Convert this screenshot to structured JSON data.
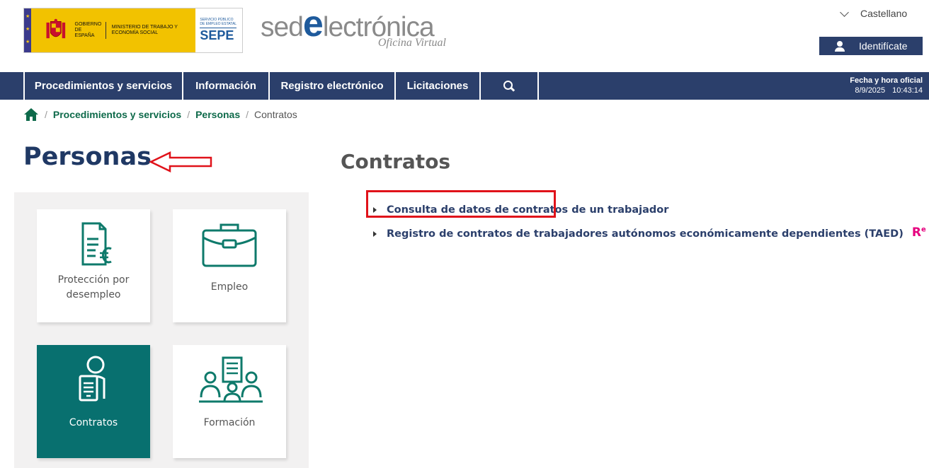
{
  "header": {
    "gov_text_1": "GOBIERNO DE ESPAÑA",
    "gov_text_2": "MINISTERIO DE TRABAJO Y ECONOMÍA SOCIAL",
    "sepe_small": "SERVICIO PÚBLICO DE EMPLEO ESTATAL",
    "sepe_big": "SEPE",
    "sede_part1": "sed",
    "sede_e": "e",
    "sede_part2": "lectrónica",
    "sede_sub": "Oficina Virtual",
    "language": "Castellano",
    "login_label": "Identifícate"
  },
  "nav": {
    "items": [
      {
        "label": "Procedimientos y servicios"
      },
      {
        "label": "Información"
      },
      {
        "label": "Registro electrónico"
      },
      {
        "label": "Licitaciones"
      }
    ],
    "search_icon": "search-icon",
    "date_label": "Fecha y hora oficial",
    "date": "8/9/2025",
    "time": "10:43:14"
  },
  "breadcrumb": {
    "items": [
      "Procedimientos y servicios",
      "Personas"
    ],
    "current": "Contratos",
    "separator": "/"
  },
  "left": {
    "title": "Personas",
    "cards": [
      {
        "label": "Protección por desempleo",
        "icon": "document-euro-icon"
      },
      {
        "label": "Empleo",
        "icon": "briefcase-icon"
      },
      {
        "label": "Contratos",
        "icon": "contract-person-icon",
        "active": true
      },
      {
        "label": "Formación",
        "icon": "training-group-icon"
      }
    ]
  },
  "right": {
    "title": "Contratos",
    "links": [
      {
        "label": "Consulta de datos de contratos de un trabajador"
      },
      {
        "label": "Registro de contratos de trabajadores autónomos económicamente dependientes (TAED)",
        "badge": "R",
        "badge_sup": "e"
      }
    ]
  },
  "colors": {
    "nav_bg": "#2b3f6b",
    "accent_green": "#08706f",
    "link_green": "#0e6a4a",
    "highlight_red": "#e0121a",
    "badge_pink": "#e6007e"
  }
}
